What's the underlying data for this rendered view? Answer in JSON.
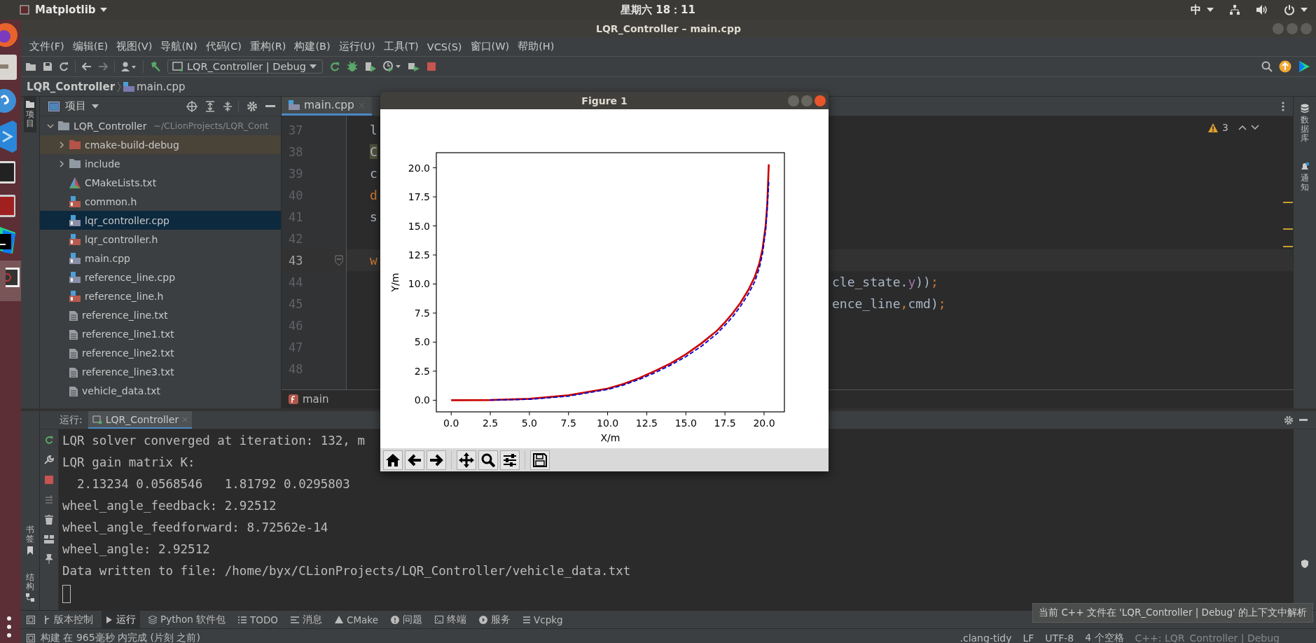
{
  "top_bar": {
    "app_menu": "Matplotlib",
    "clock": "星期六 18：11",
    "input_method": "中"
  },
  "window": {
    "title": "LQR_Controller – main.cpp"
  },
  "menu": [
    "文件(F)",
    "编辑(E)",
    "视图(V)",
    "导航(N)",
    "代码(C)",
    "重构(R)",
    "构建(B)",
    "运行(U)",
    "工具(T)",
    "VCS(S)",
    "窗口(W)",
    "帮助(H)"
  ],
  "toolbar": {
    "run_configuration": "LQR_Controller | Debug"
  },
  "breadcrumb": [
    "LQR_Controller",
    "main.cpp"
  ],
  "left_stripe": {
    "top": "项目",
    "bottom": [
      "书签",
      "结构"
    ]
  },
  "right_stripe": [
    "数据库",
    "通知"
  ],
  "project_panel": {
    "title": "项目",
    "root": {
      "name": "LQR_Controller",
      "path": "~/CLionProjects/LQR_Cont",
      "expanded": true,
      "children": [
        {
          "name": "cmake-build-debug",
          "kind": "build-folder",
          "expanded": false,
          "selected": false
        },
        {
          "name": "include",
          "kind": "folder",
          "expanded": false,
          "selected": false
        },
        {
          "name": "CMakeLists.txt",
          "kind": "cmake",
          "selected": false
        },
        {
          "name": "common.h",
          "kind": "header",
          "selected": false
        },
        {
          "name": "lqr_controller.cpp",
          "kind": "cpp",
          "selected": true
        },
        {
          "name": "lqr_controller.h",
          "kind": "header",
          "selected": false
        },
        {
          "name": "main.cpp",
          "kind": "cpp",
          "selected": false
        },
        {
          "name": "reference_line.cpp",
          "kind": "cpp",
          "selected": false
        },
        {
          "name": "reference_line.h",
          "kind": "header",
          "selected": false
        },
        {
          "name": "reference_line.txt",
          "kind": "text",
          "selected": false
        },
        {
          "name": "reference_line1.txt",
          "kind": "text",
          "selected": false
        },
        {
          "name": "reference_line2.txt",
          "kind": "text",
          "selected": false
        },
        {
          "name": "reference_line3.txt",
          "kind": "text",
          "selected": false
        },
        {
          "name": "vehicle_data.txt",
          "kind": "text",
          "selected": false
        }
      ]
    }
  },
  "editor": {
    "tabs": [
      {
        "label": "main.cpp",
        "selected": true
      }
    ],
    "warnings": "3",
    "lines": [
      {
        "number": "37",
        "current": false,
        "left": [
          {
            "text": "l",
            "kind": "plain"
          }
        ]
      },
      {
        "number": "38",
        "current": false,
        "left": [
          {
            "text": "C",
            "kind": "usage"
          }
        ]
      },
      {
        "number": "39",
        "current": false,
        "left": [
          {
            "text": "c",
            "kind": "plain"
          }
        ]
      },
      {
        "number": "40",
        "current": false,
        "left": [
          {
            "text": "d",
            "kind": "keyword"
          }
        ]
      },
      {
        "number": "41",
        "current": false,
        "left": [
          {
            "text": "s",
            "kind": "plain"
          }
        ]
      },
      {
        "number": "42",
        "current": false
      },
      {
        "number": "43",
        "current": true,
        "left": [
          {
            "text": "w",
            "kind": "keyword"
          }
        ]
      },
      {
        "number": "44",
        "current": false,
        "right": [
          {
            "text": "cle_state.",
            "kind": "plain"
          },
          {
            "text": "y",
            "kind": "field"
          },
          {
            "text": "))",
            "kind": "plain"
          },
          {
            "text": ";",
            "kind": "keyword"
          }
        ]
      },
      {
        "number": "45",
        "current": false,
        "right": [
          {
            "text": "ence_line",
            "kind": "plain"
          },
          {
            "text": ",",
            "kind": "keyword"
          },
          {
            "text": "cmd)",
            "kind": "plain"
          },
          {
            "text": ";",
            "kind": "keyword"
          }
        ]
      },
      {
        "number": "46",
        "current": false
      },
      {
        "number": "47",
        "current": false
      },
      {
        "number": "48",
        "current": false
      }
    ],
    "function_breadcrumb": "main"
  },
  "figure": {
    "title": "Figure 1",
    "chart_data": {
      "type": "line",
      "xlabel": "X/m",
      "ylabel": "Y/m",
      "x": [
        0,
        2.5,
        5,
        7.5,
        10,
        11,
        12,
        13,
        14,
        15,
        16,
        17,
        17.5,
        18,
        18.5,
        19,
        19.4,
        19.7,
        19.9,
        20.1,
        20.2,
        20.3
      ],
      "series": [
        {
          "color": "#cc0000",
          "line_style": "solid",
          "values": [
            0,
            0.02,
            0.12,
            0.42,
            1.0,
            1.4,
            1.9,
            2.5,
            3.15,
            3.95,
            4.9,
            6.0,
            6.7,
            7.5,
            8.4,
            9.5,
            10.6,
            11.8,
            13.0,
            15.0,
            16.8,
            20.3
          ]
        },
        {
          "color": "#0000cc",
          "line_style": "dashed",
          "values": [
            null,
            0.01,
            0.08,
            0.35,
            0.92,
            1.3,
            1.78,
            2.35,
            3.0,
            3.75,
            4.65,
            5.75,
            6.45,
            7.2,
            8.1,
            9.15,
            10.2,
            11.4,
            12.6,
            14.6,
            16.4,
            18.8
          ]
        }
      ],
      "xlim": [
        -0.95,
        21.3
      ],
      "ylim": [
        -1.0,
        21.3
      ],
      "xticks": [
        {
          "value": 0,
          "label": "0.0"
        },
        {
          "value": 2.5,
          "label": "2.5"
        },
        {
          "value": 5,
          "label": "5.0"
        },
        {
          "value": 7.5,
          "label": "7.5"
        },
        {
          "value": 10,
          "label": "10.0"
        },
        {
          "value": 12.5,
          "label": "12.5"
        },
        {
          "value": 15,
          "label": "15.0"
        },
        {
          "value": 17.5,
          "label": "17.5"
        },
        {
          "value": 20,
          "label": "20.0"
        }
      ],
      "yticks": [
        {
          "value": 0,
          "label": "0.0"
        },
        {
          "value": 2.5,
          "label": "2.5"
        },
        {
          "value": 5,
          "label": "5.0"
        },
        {
          "value": 7.5,
          "label": "7.5"
        },
        {
          "value": 10,
          "label": "10.0"
        },
        {
          "value": 12.5,
          "label": "12.5"
        },
        {
          "value": 15,
          "label": "15.0"
        },
        {
          "value": 17.5,
          "label": "17.5"
        },
        {
          "value": 20,
          "label": "20.0"
        }
      ]
    }
  },
  "run_panel": {
    "label": "运行:",
    "tabs": [
      {
        "label": "LQR_Controller",
        "selected": true
      }
    ],
    "output": [
      "LQR solver converged at iteration: 132, m",
      "LQR gain matrix K:",
      "  2.13234 0.0568546   1.81792 0.0295803",
      "wheel_angle_feedback: 2.92512",
      "wheel_angle_feedforward: 8.72562e-14",
      "wheel_angle: 2.92512",
      "Data written to file: /home/byx/CLionProjects/LQR_Controller/vehicle_data.txt"
    ]
  },
  "tool_tabs": [
    {
      "label": "版本控制",
      "kind": "vcs",
      "selected": false
    },
    {
      "label": "运行",
      "kind": "run",
      "selected": true
    },
    {
      "label": "Python 软件包",
      "kind": "python",
      "selected": false
    },
    {
      "label": "TODO",
      "kind": "todo",
      "selected": false
    },
    {
      "label": "消息",
      "kind": "messages",
      "selected": false
    },
    {
      "label": "CMake",
      "kind": "cmake",
      "selected": false
    },
    {
      "label": "问题",
      "kind": "problems",
      "selected": false
    },
    {
      "label": "终端",
      "kind": "terminal",
      "selected": false
    },
    {
      "label": "服务",
      "kind": "services",
      "selected": false
    },
    {
      "label": "Vcpkg",
      "kind": "vcpkg",
      "selected": false
    }
  ],
  "status_bar": {
    "message": "构建 在 965毫秒 内完成 (片刻 之前)",
    "items": [
      ".clang-tidy",
      "LF",
      "UTF-8",
      "4 个空格",
      "C++: LQR_Controller | Debug"
    ]
  },
  "tooltip": "当前 C++ 文件在 'LQR_Controller | Debug' 的上下文中解析"
}
